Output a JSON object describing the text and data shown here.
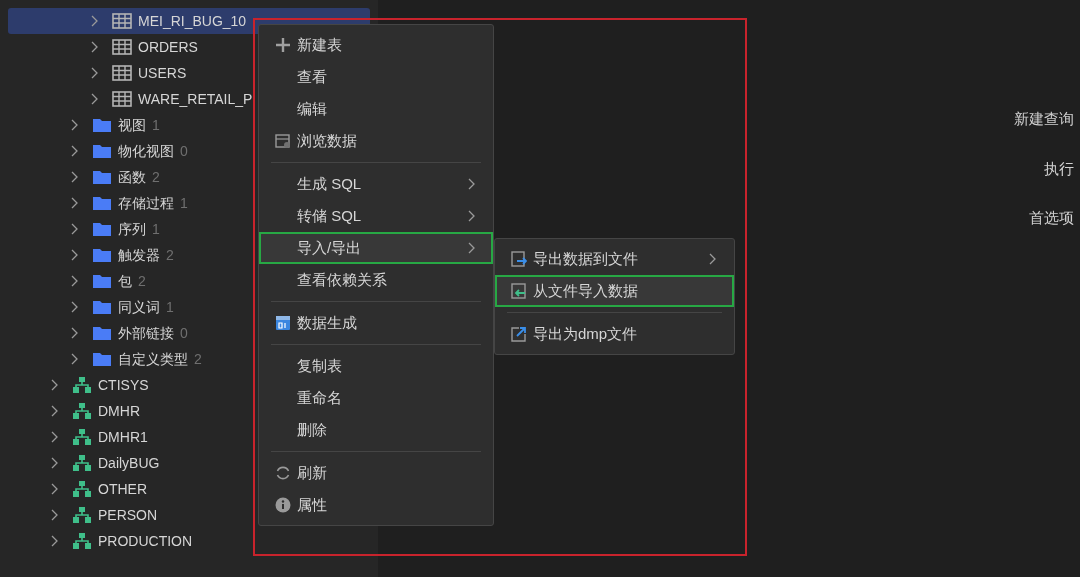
{
  "tree": [
    {
      "kind": "group",
      "children": [
        {
          "kind": "group",
          "children": [
            {
              "kind": "table",
              "label": "MEI_RI_BUG_10",
              "selected": true
            },
            {
              "kind": "table",
              "label": "ORDERS",
              "selected": false
            },
            {
              "kind": "table",
              "label": "USERS",
              "selected": false
            },
            {
              "kind": "table",
              "label": "WARE_RETAIL_P",
              "selected": false
            }
          ]
        },
        {
          "kind": "folder",
          "label": "视图",
          "count": "1",
          "selected": false
        },
        {
          "kind": "folder",
          "label": "物化视图",
          "count": "0",
          "selected": false
        },
        {
          "kind": "folder",
          "label": "函数",
          "count": "2",
          "selected": false
        },
        {
          "kind": "folder",
          "label": "存储过程",
          "count": "1",
          "selected": false
        },
        {
          "kind": "folder",
          "label": "序列",
          "count": "1",
          "selected": false
        },
        {
          "kind": "folder",
          "label": "触发器",
          "count": "2",
          "selected": false
        },
        {
          "kind": "folder",
          "label": "包",
          "count": "2",
          "selected": false
        },
        {
          "kind": "folder",
          "label": "同义词",
          "count": "1",
          "selected": false
        },
        {
          "kind": "folder",
          "label": "外部链接",
          "count": "0",
          "selected": false
        },
        {
          "kind": "folder",
          "label": "自定义类型",
          "count": "2",
          "selected": false
        }
      ]
    },
    {
      "kind": "schema",
      "label": "CTISYS",
      "selected": false
    },
    {
      "kind": "schema",
      "label": "DMHR",
      "selected": false
    },
    {
      "kind": "schema",
      "label": "DMHR1",
      "selected": false
    },
    {
      "kind": "schema",
      "label": "DailyBUG",
      "selected": false
    },
    {
      "kind": "schema",
      "label": "OTHER",
      "selected": false
    },
    {
      "kind": "schema",
      "label": "PERSON",
      "selected": false
    },
    {
      "kind": "schema",
      "label": "PRODUCTION",
      "selected": false
    }
  ],
  "context_menu": {
    "groups": [
      [
        {
          "label": "新建表",
          "kind": "plus",
          "submenu": false,
          "highlighted": false
        },
        {
          "label": "查看",
          "kind": "plain",
          "submenu": false,
          "highlighted": false
        },
        {
          "label": "编辑",
          "kind": "plain",
          "submenu": false,
          "highlighted": false
        },
        {
          "label": "浏览数据",
          "kind": "browse",
          "submenu": false,
          "highlighted": false
        }
      ],
      [
        {
          "label": "生成 SQL",
          "kind": "plain",
          "submenu": true,
          "highlighted": false
        },
        {
          "label": "转储 SQL",
          "kind": "plain",
          "submenu": true,
          "highlighted": false
        },
        {
          "label": "导入/导出",
          "kind": "plain",
          "submenu": true,
          "highlighted": true
        },
        {
          "label": "查看依赖关系",
          "kind": "plain",
          "submenu": false,
          "highlighted": false
        }
      ],
      [
        {
          "label": "数据生成",
          "kind": "datagen",
          "submenu": false,
          "highlighted": false
        }
      ],
      [
        {
          "label": "复制表",
          "kind": "plain",
          "submenu": false,
          "highlighted": false
        },
        {
          "label": "重命名",
          "kind": "plain",
          "submenu": false,
          "highlighted": false
        },
        {
          "label": "删除",
          "kind": "plain",
          "submenu": false,
          "highlighted": false
        }
      ],
      [
        {
          "label": "刷新",
          "kind": "refresh",
          "submenu": false,
          "highlighted": false
        },
        {
          "label": "属性",
          "kind": "info",
          "submenu": false,
          "highlighted": false
        }
      ]
    ]
  },
  "submenu": {
    "groups": [
      [
        {
          "label": "导出数据到文件",
          "kind": "export",
          "submenu": true,
          "highlighted": false
        },
        {
          "label": "从文件导入数据",
          "kind": "import",
          "submenu": false,
          "highlighted": true
        }
      ],
      [
        {
          "label": "导出为dmp文件",
          "kind": "dmp",
          "submenu": false,
          "highlighted": false
        }
      ]
    ]
  },
  "toolbar": [
    {
      "label": "新建查询"
    },
    {
      "label": "执行"
    },
    {
      "label": "首选项"
    }
  ]
}
